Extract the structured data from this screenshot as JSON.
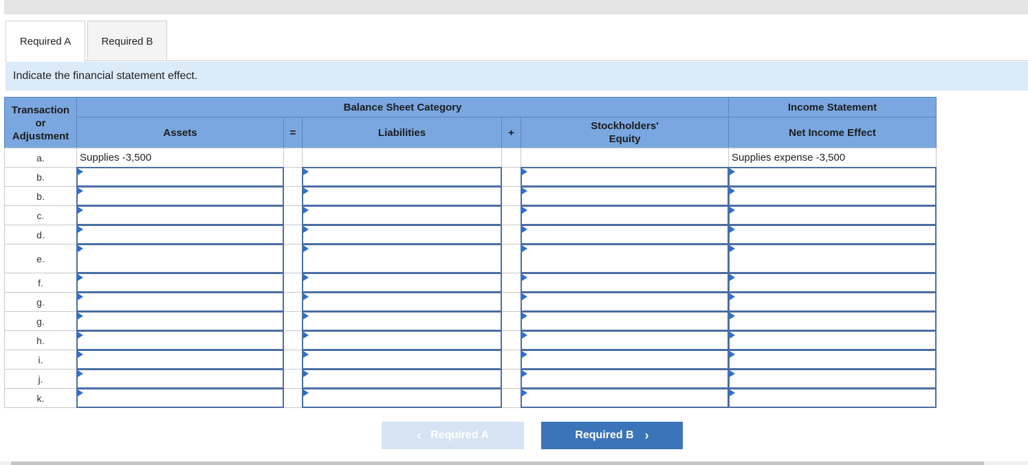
{
  "tabs": [
    {
      "label": "Required A",
      "active": true
    },
    {
      "label": "Required B",
      "active": false
    }
  ],
  "instruction": "Indicate the financial statement effect.",
  "table": {
    "header": {
      "transaction_col": [
        "Transaction",
        "or",
        "Adjustment"
      ],
      "balance_sheet_group": "Balance Sheet Category",
      "income_group": "Income Statement",
      "assets": "Assets",
      "equals": "=",
      "liabilities": "Liabilities",
      "plus": "+",
      "equity": "Stockholders' Equity",
      "net_income": "Net Income Effect"
    },
    "first_row": {
      "label": "a.",
      "assets": "Supplies -3,500",
      "liabilities": "",
      "equity": "",
      "net_income": "Supplies expense -3,500"
    },
    "input_rows": [
      "b.",
      "b.",
      "c.",
      "d.",
      "e.",
      "f.",
      "g.",
      "g.",
      "h.",
      "i.",
      "j.",
      "k."
    ]
  },
  "nav": {
    "prev_label": "Required A",
    "next_label": "Required B",
    "prev_icon": "chevron-left-icon",
    "next_icon": "chevron-right-icon"
  },
  "colors": {
    "header_bg": "#7aa7e0",
    "instruction_bg": "#dcebf8",
    "next_button_bg": "#3b74b8",
    "prev_button_bg": "#d6e3f2",
    "input_border": "#4a6da3"
  }
}
